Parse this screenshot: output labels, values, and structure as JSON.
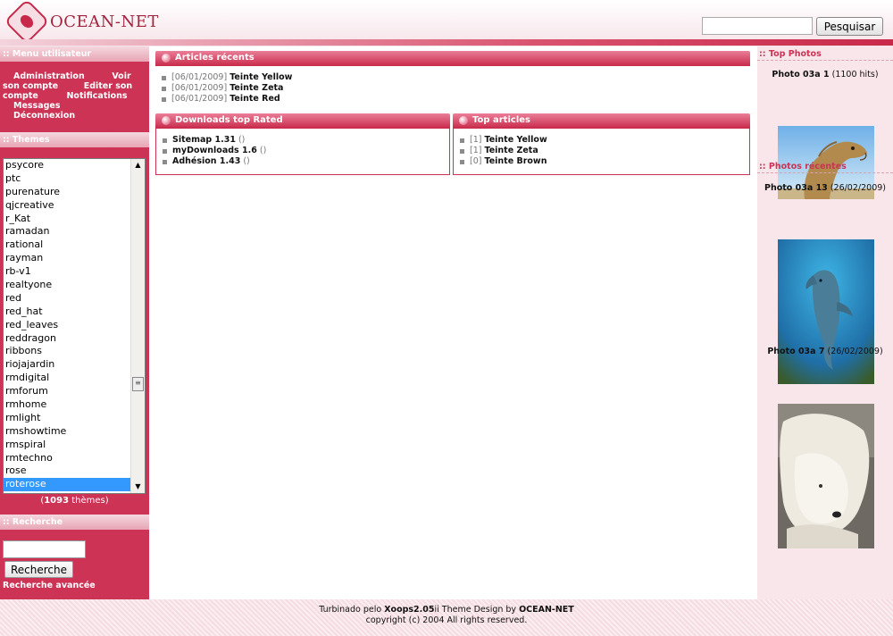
{
  "header": {
    "logo_text": "OCEAN-NET",
    "search_button": "Pesquisar"
  },
  "left": {
    "menu_title": ":: Menu utilisateur",
    "menu_items": [
      "Administration",
      "Voir son compte",
      "Editer son compte",
      "Notifications",
      "Messages",
      "Déconnexion"
    ],
    "themes_title": ":: Themes",
    "themes": [
      "psycore",
      "ptc",
      "purenature",
      "qjcreative",
      "r_Kat",
      "ramadan",
      "rational",
      "rayman",
      "rb-v1",
      "realtyone",
      "red",
      "red_hat",
      "red_leaves",
      "reddragon",
      "ribbons",
      "riojajardin",
      "rmdigital",
      "rmforum",
      "rmhome",
      "rmlight",
      "rmshowtime",
      "rmspiral",
      "rmtechno",
      "rose",
      "roterose"
    ],
    "selected_theme": "roterose",
    "theme_count_open": "(",
    "theme_count": "1093",
    "theme_count_suffix": " thèmes)",
    "search_title": ":: Recherche",
    "search_button": "Recherche",
    "advanced_search": "Recherche avancée"
  },
  "center": {
    "articles_title": "Articles récents",
    "recent_articles": [
      {
        "date": "[06/01/2009]",
        "title": "Teinte Yellow"
      },
      {
        "date": "[06/01/2009]",
        "title": "Teinte Zeta"
      },
      {
        "date": "[06/01/2009]",
        "title": "Teinte Red"
      }
    ],
    "downloads_title": "Downloads top Rated",
    "downloads": [
      {
        "title": "Sitemap 1.31",
        "extra": " ()"
      },
      {
        "title": "myDownloads 1.6",
        "extra": " ()"
      },
      {
        "title": "Adhésion 1.43",
        "extra": " ()"
      }
    ],
    "top_articles_title": "Top articles",
    "top_articles": [
      {
        "rank": "[1]",
        "title": "Teinte Yellow"
      },
      {
        "rank": "[1]",
        "title": "Teinte Zeta"
      },
      {
        "rank": "[0]",
        "title": "Teinte Brown"
      }
    ]
  },
  "right": {
    "top_photos_title": ":: Top Photos",
    "top_photo": {
      "title": "Photo 03a 1",
      "meta": " (1100 hits)",
      "icon": "camel-photo"
    },
    "recent_photos_title": ":: Photos récentes",
    "recent_photos": [
      {
        "title": "Photo 03a 13",
        "meta": " (26/02/2009)",
        "icon": "dolphin-photo"
      },
      {
        "title": "Photo 03a 7",
        "meta": " (26/02/2009)",
        "icon": "polar-bear-photo"
      }
    ]
  },
  "footer": {
    "line1_pre": "Turbinado pelo ",
    "line1_xoops": "Xoops2.05",
    "line1_mid": "ii Theme Design by ",
    "line1_brand": "OCEAN-NET",
    "line2": "copyright (c) 2004 All rights reserved."
  },
  "colors": {
    "accent": "#cc3355",
    "selected": "#3399ff",
    "right_bg": "#f9e6eb"
  }
}
